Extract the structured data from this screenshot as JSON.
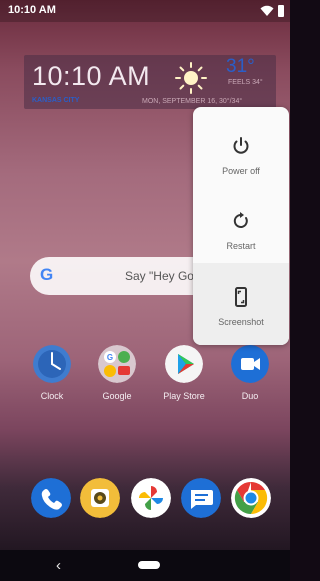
{
  "status_bar": {
    "time": "10:10 AM"
  },
  "weather_widget": {
    "time": "10:10 AM",
    "city": "KANSAS CITY",
    "temperature": "31°",
    "feels_like": "FEELS 34°",
    "date": "MON, SEPTEMBER 16, 30°/34°"
  },
  "search_bar": {
    "placeholder_text": "Say \"Hey Go"
  },
  "power_menu": {
    "items": [
      {
        "label": "Power off",
        "icon": "power-icon"
      },
      {
        "label": "Restart",
        "icon": "restart-icon"
      },
      {
        "label": "Screenshot",
        "icon": "screenshot-icon"
      }
    ]
  },
  "apps": [
    {
      "label": "Clock",
      "icon": "clock-icon"
    },
    {
      "label": "Google",
      "icon": "google-folder-icon"
    },
    {
      "label": "Play Store",
      "icon": "play-store-icon"
    },
    {
      "label": "Duo",
      "icon": "duo-icon"
    }
  ],
  "dock": [
    {
      "icon": "phone-icon",
      "color": "#1e6fd6"
    },
    {
      "icon": "camera-icon",
      "color": "#f2bd3a"
    },
    {
      "icon": "photos-icon",
      "color": "#ffffff"
    },
    {
      "icon": "messages-icon",
      "color": "#1e6fd6"
    },
    {
      "icon": "chrome-icon",
      "color": "#ffffff"
    }
  ],
  "colors": {
    "accent_blue": "#2a5ec8",
    "menu_bg": "#fafafa"
  }
}
